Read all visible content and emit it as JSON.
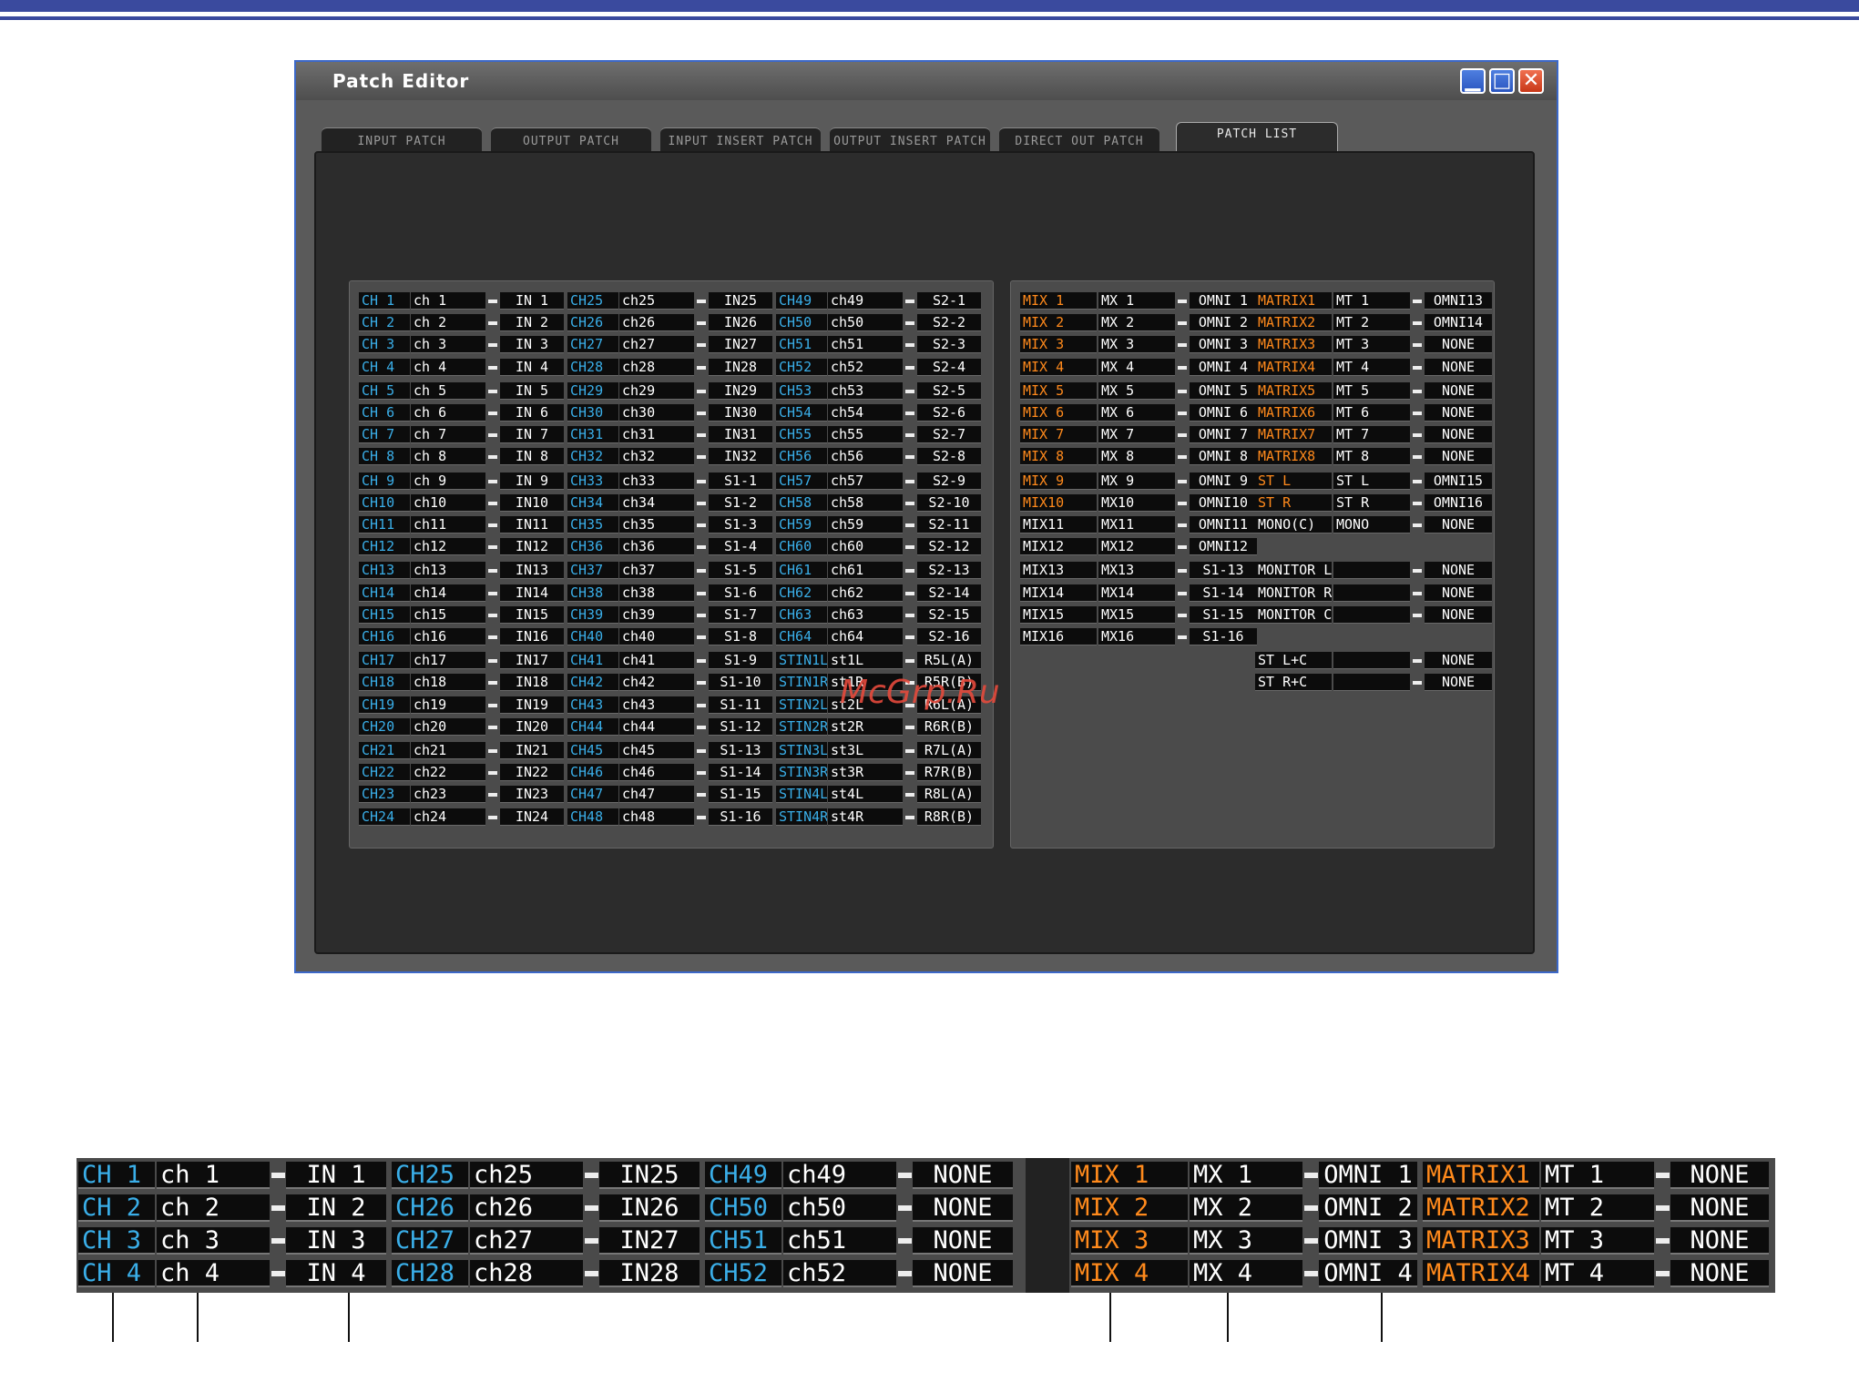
{
  "window": {
    "title": "Patch Editor",
    "minimize": "▁",
    "maximize": "□",
    "close": "✕"
  },
  "tabs": [
    "INPUT PATCH",
    "OUTPUT PATCH",
    "INPUT INSERT PATCH",
    "OUTPUT INSERT PATCH",
    "DIRECT OUT PATCH",
    "PATCH LIST"
  ],
  "active_tab": "PATCH LIST",
  "watermark": "McGrp.Ru",
  "input_list": {
    "columns": [
      {
        "channels": [
          "CH 1",
          "CH 2",
          "CH 3",
          "CH 4",
          "CH 5",
          "CH 6",
          "CH 7",
          "CH 8",
          "CH 9",
          "CH10",
          "CH11",
          "CH12",
          "CH13",
          "CH14",
          "CH15",
          "CH16",
          "CH17",
          "CH18",
          "CH19",
          "CH20",
          "CH21",
          "CH22",
          "CH23",
          "CH24"
        ],
        "names": [
          "ch 1",
          "ch 2",
          "ch 3",
          "ch 4",
          "ch 5",
          "ch 6",
          "ch 7",
          "ch 8",
          "ch 9",
          "ch10",
          "ch11",
          "ch12",
          "ch13",
          "ch14",
          "ch15",
          "ch16",
          "ch17",
          "ch18",
          "ch19",
          "ch20",
          "ch21",
          "ch22",
          "ch23",
          "ch24"
        ],
        "ports": [
          "IN 1",
          "IN 2",
          "IN 3",
          "IN 4",
          "IN 5",
          "IN 6",
          "IN 7",
          "IN 8",
          "IN 9",
          "IN10",
          "IN11",
          "IN12",
          "IN13",
          "IN14",
          "IN15",
          "IN16",
          "IN17",
          "IN18",
          "IN19",
          "IN20",
          "IN21",
          "IN22",
          "IN23",
          "IN24"
        ]
      },
      {
        "channels": [
          "CH25",
          "CH26",
          "CH27",
          "CH28",
          "CH29",
          "CH30",
          "CH31",
          "CH32",
          "CH33",
          "CH34",
          "CH35",
          "CH36",
          "CH37",
          "CH38",
          "CH39",
          "CH40",
          "CH41",
          "CH42",
          "CH43",
          "CH44",
          "CH45",
          "CH46",
          "CH47",
          "CH48"
        ],
        "names": [
          "ch25",
          "ch26",
          "ch27",
          "ch28",
          "ch29",
          "ch30",
          "ch31",
          "ch32",
          "ch33",
          "ch34",
          "ch35",
          "ch36",
          "ch37",
          "ch38",
          "ch39",
          "ch40",
          "ch41",
          "ch42",
          "ch43",
          "ch44",
          "ch45",
          "ch46",
          "ch47",
          "ch48"
        ],
        "ports": [
          "IN25",
          "IN26",
          "IN27",
          "IN28",
          "IN29",
          "IN30",
          "IN31",
          "IN32",
          "S1-1",
          "S1-2",
          "S1-3",
          "S1-4",
          "S1-5",
          "S1-6",
          "S1-7",
          "S1-8",
          "S1-9",
          "S1-10",
          "S1-11",
          "S1-12",
          "S1-13",
          "S1-14",
          "S1-15",
          "S1-16"
        ]
      },
      {
        "channels": [
          "CH49",
          "CH50",
          "CH51",
          "CH52",
          "CH53",
          "CH54",
          "CH55",
          "CH56",
          "CH57",
          "CH58",
          "CH59",
          "CH60",
          "CH61",
          "CH62",
          "CH63",
          "CH64",
          "STIN1L",
          "STIN1R",
          "STIN2L",
          "STIN2R",
          "STIN3L",
          "STIN3R",
          "STIN4L",
          "STIN4R"
        ],
        "names": [
          "ch49",
          "ch50",
          "ch51",
          "ch52",
          "ch53",
          "ch54",
          "ch55",
          "ch56",
          "ch57",
          "ch58",
          "ch59",
          "ch60",
          "ch61",
          "ch62",
          "ch63",
          "ch64",
          "st1L",
          "st1R",
          "st2L",
          "st2R",
          "st3L",
          "st3R",
          "st4L",
          "st4R"
        ],
        "ports": [
          "S2-1",
          "S2-2",
          "S2-3",
          "S2-4",
          "S2-5",
          "S2-6",
          "S2-7",
          "S2-8",
          "S2-9",
          "S2-10",
          "S2-11",
          "S2-12",
          "S2-13",
          "S2-14",
          "S2-15",
          "S2-16",
          "R5L(A)",
          "R5R(B)",
          "R6L(A)",
          "R6R(B)",
          "R7L(A)",
          "R7R(B)",
          "R8L(A)",
          "R8R(B)"
        ]
      }
    ]
  },
  "output_list": {
    "mix": {
      "channels": [
        "MIX 1",
        "MIX 2",
        "MIX 3",
        "MIX 4",
        "MIX 5",
        "MIX 6",
        "MIX 7",
        "MIX 8",
        "MIX 9",
        "MIX10",
        "MIX11",
        "MIX12",
        "MIX13",
        "MIX14",
        "MIX15",
        "MIX16"
      ],
      "names": [
        "MX 1",
        "MX 2",
        "MX 3",
        "MX 4",
        "MX 5",
        "MX 6",
        "MX 7",
        "MX 8",
        "MX 9",
        "MX10",
        "MX11",
        "MX12",
        "MX13",
        "MX14",
        "MX15",
        "MX16"
      ],
      "ports": [
        "OMNI 1",
        "OMNI 2",
        "OMNI 3",
        "OMNI 4",
        "OMNI 5",
        "OMNI 6",
        "OMNI 7",
        "OMNI 8",
        "OMNI 9",
        "OMNI10",
        "OMNI11",
        "OMNI12",
        "S1-13",
        "S1-14",
        "S1-15",
        "S1-16"
      ]
    },
    "matrix": {
      "channels": [
        "MATRIX1",
        "MATRIX2",
        "MATRIX3",
        "MATRIX4",
        "MATRIX5",
        "MATRIX6",
        "MATRIX7",
        "MATRIX8",
        "ST L",
        "ST R",
        "MONO(C)"
      ],
      "names": [
        "MT 1",
        "MT 2",
        "MT 3",
        "MT 4",
        "MT 5",
        "MT 6",
        "MT 7",
        "MT 8",
        "ST L",
        "ST R",
        "MONO"
      ],
      "ports": [
        "OMNI13",
        "OMNI14",
        "NONE",
        "NONE",
        "NONE",
        "NONE",
        "NONE",
        "NONE",
        "OMNI15",
        "OMNI16",
        "NONE"
      ]
    },
    "monitor": {
      "channels": [
        "MONITOR L",
        "MONITOR R",
        "MONITOR C"
      ],
      "names": [
        "",
        "",
        ""
      ],
      "ports": [
        "NONE",
        "NONE",
        "NONE"
      ]
    },
    "stlc": {
      "channels": [
        "ST L+C",
        "ST R+C"
      ],
      "names": [
        "",
        ""
      ],
      "ports": [
        "NONE",
        "NONE"
      ]
    }
  },
  "zoom": {
    "input_columns": [
      {
        "channels": [
          "CH 1",
          "CH 2",
          "CH 3",
          "CH 4"
        ],
        "names": [
          "ch 1",
          "ch 2",
          "ch 3",
          "ch 4"
        ],
        "ports": [
          "IN 1",
          "IN 2",
          "IN 3",
          "IN 4"
        ]
      },
      {
        "channels": [
          "CH25",
          "CH26",
          "CH27",
          "CH28"
        ],
        "names": [
          "ch25",
          "ch26",
          "ch27",
          "ch28"
        ],
        "ports": [
          "IN25",
          "IN26",
          "IN27",
          "IN28"
        ]
      },
      {
        "channels": [
          "CH49",
          "CH50",
          "CH51",
          "CH52"
        ],
        "names": [
          "ch49",
          "ch50",
          "ch51",
          "ch52"
        ],
        "ports": [
          "NONE",
          "NONE",
          "NONE",
          "NONE"
        ]
      }
    ],
    "output_columns": [
      {
        "channels": [
          "MIX 1",
          "MIX 2",
          "MIX 3",
          "MIX 4"
        ],
        "names": [
          "MX 1",
          "MX 2",
          "MX 3",
          "MX 4"
        ],
        "ports": [
          "OMNI 1",
          "OMNI 2",
          "OMNI 3",
          "OMNI 4"
        ]
      },
      {
        "channels": [
          "MATRIX1",
          "MATRIX2",
          "MATRIX3",
          "MATRIX4"
        ],
        "names": [
          "MT 1",
          "MT 2",
          "MT 3",
          "MT 4"
        ],
        "ports": [
          "NONE",
          "NONE",
          "NONE",
          "NONE"
        ]
      }
    ]
  }
}
